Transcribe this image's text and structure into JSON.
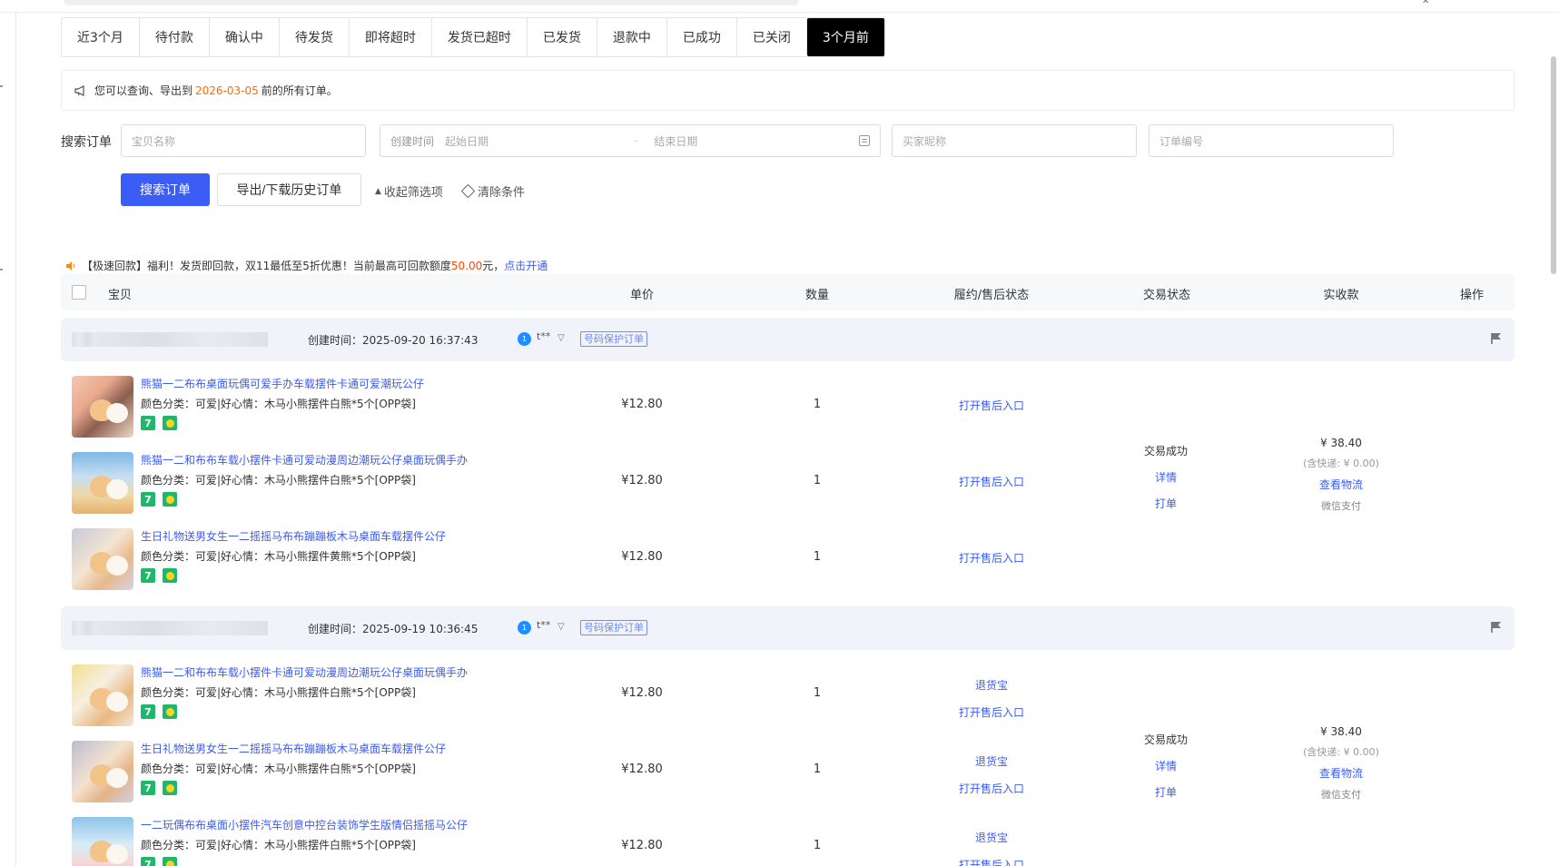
{
  "tabs": [
    "近3个月",
    "待付款",
    "确认中",
    "待发货",
    "即将超时",
    "发货已超时",
    "已发货",
    "退款中",
    "已成功",
    "已关闭",
    "3个月前"
  ],
  "active_tab_index": 10,
  "notice": {
    "prefix": "您可以查询、导出到",
    "date": "2026-03-05",
    "suffix": "前的所有订单。"
  },
  "filter": {
    "label": "搜索订单",
    "item_placeholder": "宝贝名称",
    "created_label": "创建时间",
    "start_placeholder": "起始日期",
    "date_sep": "-",
    "end_placeholder": "结束日期",
    "buyer_placeholder": "买家昵称",
    "order_no_placeholder": "订单编号"
  },
  "actions": {
    "search": "搜索订单",
    "export": "导出/下载历史订单",
    "collapse": "收起筛选项",
    "clear": "清除条件"
  },
  "promo": {
    "text": "【极速回款】福利！发货即回款，双11最低至5折优惠！当前最高可回款额度",
    "amount": "50.00",
    "unit": "元，",
    "link": "点击开通"
  },
  "table_headers": {
    "item": "宝贝",
    "price": "单价",
    "qty": "数量",
    "after_sale": "履约/售后状态",
    "trade_status": "交易状态",
    "paid": "实收款",
    "ops": "操作"
  },
  "orders": [
    {
      "created": "创建时间：2025-09-20 16:37:43",
      "buyer": "t**",
      "badge": "号码保护订单",
      "status": "交易成功",
      "detail": "详情",
      "print": "打单",
      "paid": "¥ 38.40",
      "shipping": "(含快递: ¥ 0.00)",
      "logistics": "查看物流",
      "pay_method": "微信支付",
      "items": [
        {
          "title": "熊猫一二布布桌面玩偶可爱手办车载摆件卡通可爱潮玩公仔",
          "spec": "颜色分类：可爱|好心情：木马小熊摆件白熊*5个[OPP袋]",
          "price": "¥12.80",
          "qty": "1",
          "after_sale": [
            "打开售后入口"
          ]
        },
        {
          "title": "熊猫一二和布布车载小摆件卡通可爱动漫周边潮玩公仔桌面玩偶手办",
          "spec": "颜色分类：可爱|好心情：木马小熊摆件白熊*5个[OPP袋]",
          "price": "¥12.80",
          "qty": "1",
          "after_sale": [
            "打开售后入口"
          ]
        },
        {
          "title": "生日礼物送男女生一二摇摇马布布蹦蹦板木马桌面车载摆件公仔",
          "spec": "颜色分类：可爱|好心情：木马小熊摆件黄熊*5个[OPP袋]",
          "price": "¥12.80",
          "qty": "1",
          "after_sale": [
            "打开售后入口"
          ]
        }
      ]
    },
    {
      "created": "创建时间：2025-09-19 10:36:45",
      "buyer": "t**",
      "badge": "号码保护订单",
      "status": "交易成功",
      "detail": "详情",
      "print": "打单",
      "paid": "¥ 38.40",
      "shipping": "(含快递: ¥ 0.00)",
      "logistics": "查看物流",
      "pay_method": "微信支付",
      "items": [
        {
          "title": "熊猫一二和布布车载小摆件卡通可爱动漫周边潮玩公仔桌面玩偶手办",
          "spec": "颜色分类：可爱|好心情：木马小熊摆件白熊*5个[OPP袋]",
          "price": "¥12.80",
          "qty": "1",
          "after_sale": [
            "退货宝",
            "打开售后入口"
          ]
        },
        {
          "title": "生日礼物送男女生一二摇摇马布布蹦蹦板木马桌面车载摆件公仔",
          "spec": "颜色分类：可爱|好心情：木马小熊摆件白熊*5个[OPP袋]",
          "price": "¥12.80",
          "qty": "1",
          "after_sale": [
            "退货宝",
            "打开售后入口"
          ]
        },
        {
          "title": "一二玩偶布布桌面小摆件汽车创意中控台装饰学生版情侣摇摇马公仔",
          "spec": "颜色分类：可爱|好心情：木马小熊摆件白熊*5个[OPP袋]",
          "price": "¥12.80",
          "qty": "1",
          "after_sale": [
            "退货宝",
            "打开售后入口"
          ]
        }
      ]
    }
  ],
  "item_tag_label": "7",
  "icons": {
    "notice": "megaphone-icon",
    "promo": "speaker-icon",
    "calendar": "calendar-icon",
    "collapse": "chevron-up-icon",
    "clear": "eraser-icon",
    "chat": "wangwang-chat-icon",
    "filter": "funnel-icon",
    "flag": "flag-icon"
  },
  "colors": {
    "primary": "#3b5cf5",
    "active_tab": "#000000",
    "date_highlight": "#ff6a00",
    "promo_amount": "#ff4400",
    "tag_green": "#1fb86b"
  }
}
